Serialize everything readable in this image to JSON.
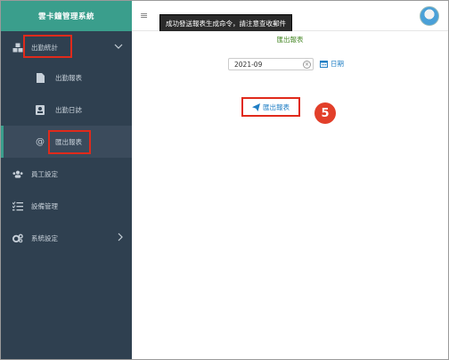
{
  "app": {
    "title": "雲卡鐘管理系統"
  },
  "sidebar": {
    "items": [
      {
        "label": "出勤統計",
        "icon": "cubes-icon",
        "expanded": true
      },
      {
        "label": "出勤報表",
        "icon": "file-icon"
      },
      {
        "label": "出勤日誌",
        "icon": "id-card-icon"
      },
      {
        "label": "匯出報表",
        "icon": "at-icon",
        "active": true
      },
      {
        "label": "員工設定",
        "icon": "users-icon"
      },
      {
        "label": "設備管理",
        "icon": "tasks-icon"
      },
      {
        "label": "系統設定",
        "icon": "cogs-icon"
      }
    ]
  },
  "topbar": {
    "toast": "成功發送報表生成命令，請注意查收郵件"
  },
  "main": {
    "title": "匯出報表",
    "month_value": "2021-09",
    "calendar_label": "日期",
    "export_label": "匯出報表",
    "step_number": "5"
  },
  "colors": {
    "sidebar_bg": "#2f4050",
    "brand_bg": "#3a9e8c",
    "highlight": "#e02a1b",
    "link": "#1f7ec4",
    "title_green": "#4a8a2a"
  }
}
